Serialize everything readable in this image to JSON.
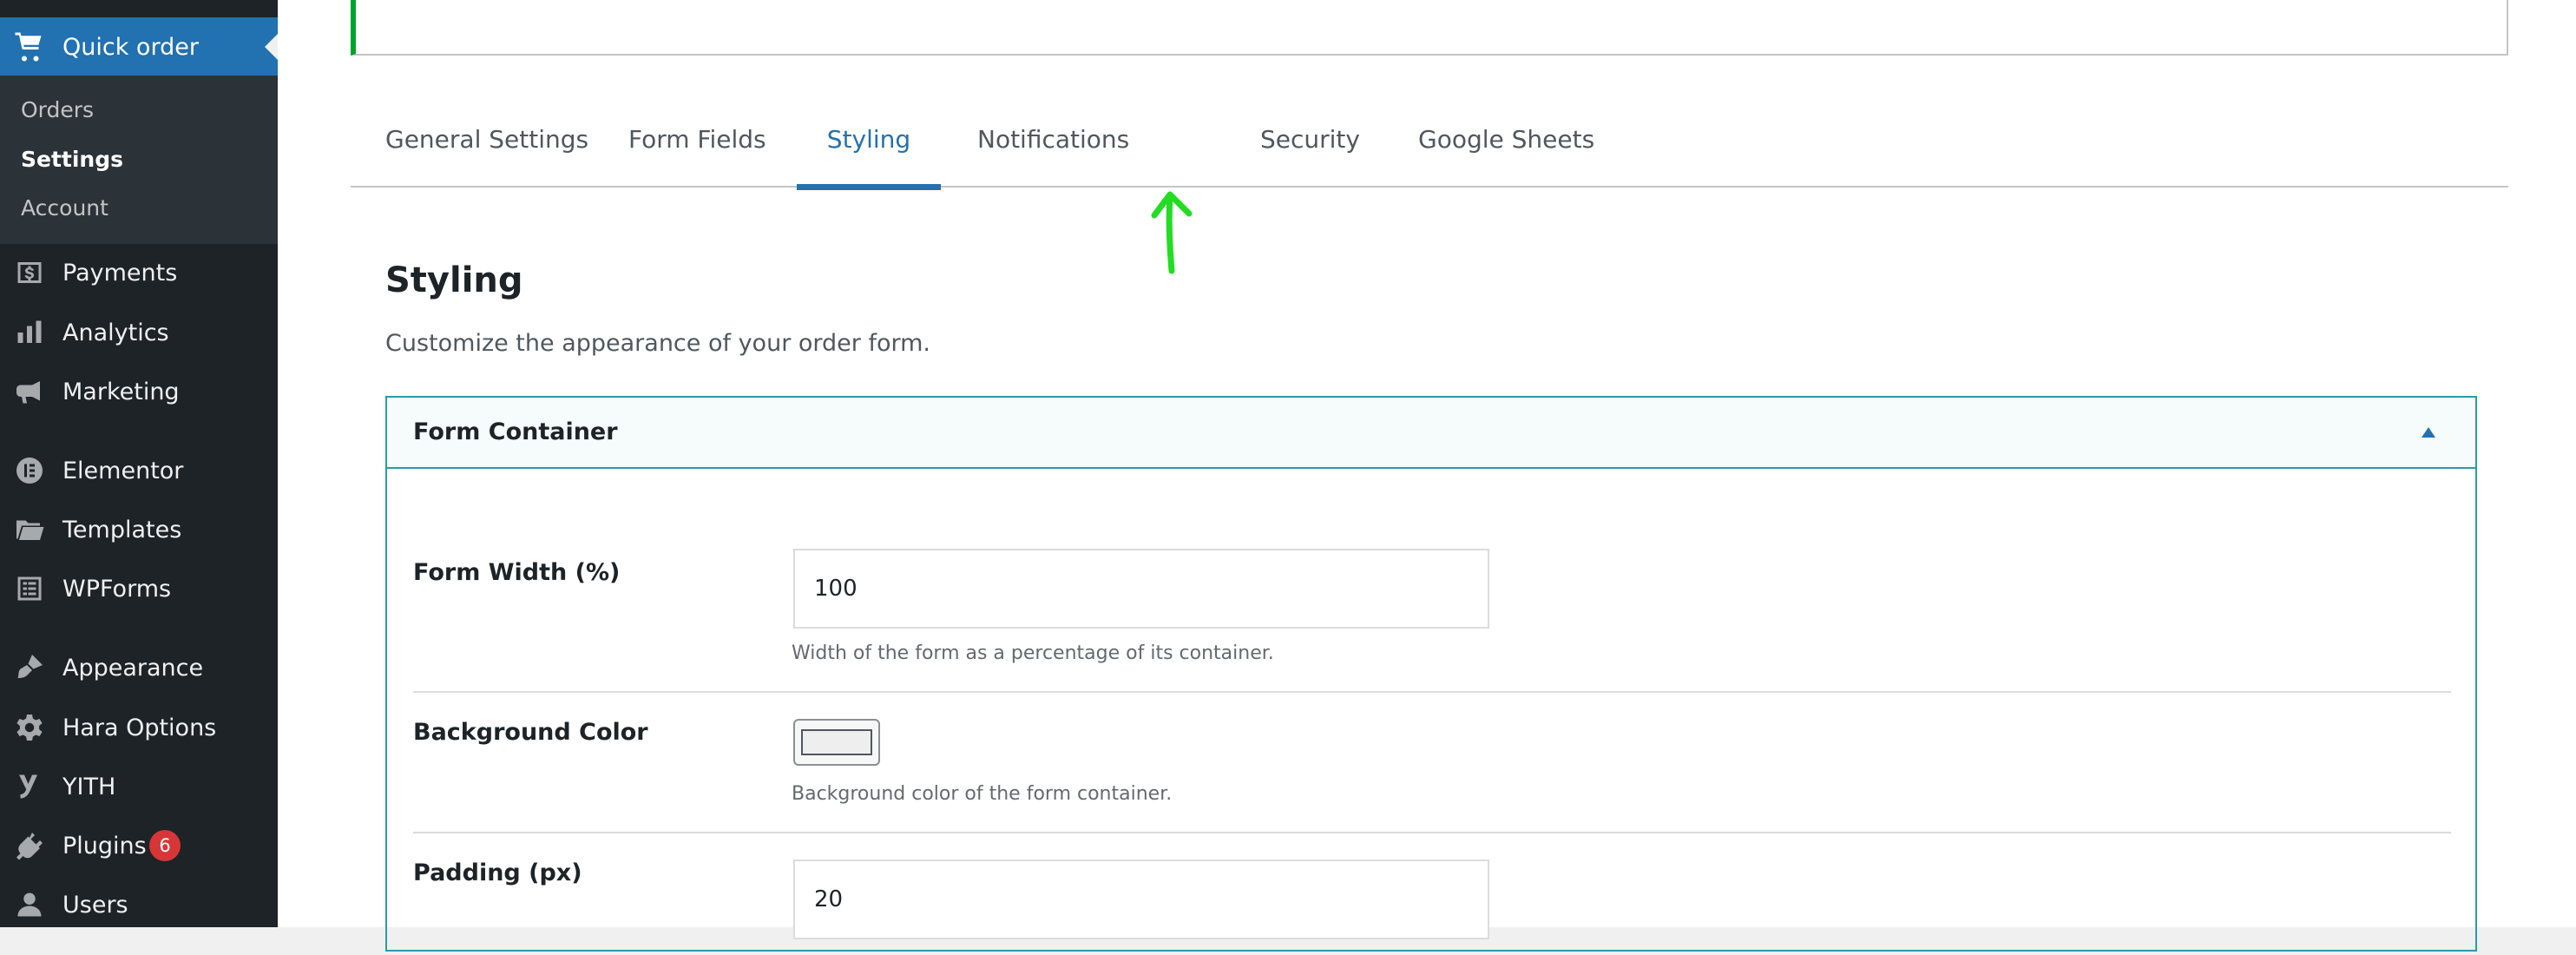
{
  "sidebar": {
    "current_item": {
      "label": "Quick order",
      "icon": "cart-icon"
    },
    "submenu": [
      "Orders",
      "Settings",
      "Account"
    ],
    "items": [
      {
        "label": "Payments",
        "icon": "dollar-icon"
      },
      {
        "label": "Analytics",
        "icon": "bar-chart-icon"
      },
      {
        "label": "Marketing",
        "icon": "megaphone-icon"
      },
      {
        "label": "Elementor",
        "icon": "elementor-icon"
      },
      {
        "label": "Templates",
        "icon": "folder-icon"
      },
      {
        "label": "WPForms",
        "icon": "form-icon"
      },
      {
        "label": "Appearance",
        "icon": "brush-icon"
      },
      {
        "label": "Hara Options",
        "icon": "gear-icon"
      },
      {
        "label": "YITH",
        "icon": "yith-icon"
      },
      {
        "label": "Plugins",
        "icon": "plug-icon",
        "badge": "6"
      },
      {
        "label": "Users",
        "icon": "user-icon"
      }
    ]
  },
  "tabs": [
    "General Settings",
    "Form Fields",
    "Styling",
    "Notifications",
    "Security",
    "Google Sheets"
  ],
  "active_tab": "Styling",
  "section": {
    "title": "Styling",
    "description": "Customize the appearance of your order form."
  },
  "panel": {
    "title": "Form Container",
    "fields": {
      "form_width": {
        "label": "Form Width (%)",
        "value": "100",
        "help": "Width of the form as a percentage of its container."
      },
      "background_color": {
        "label": "Background Color",
        "value": "#eeeeee",
        "help": "Background color of the form container."
      },
      "padding": {
        "label": "Padding (px)",
        "value": "20"
      }
    }
  },
  "colors": {
    "sidebar_bg": "#1d2327",
    "accent": "#2271b1",
    "panel_border": "#2c9aa8",
    "notice_border": "#00a32a",
    "annotation_arrow": "#22dd22"
  }
}
